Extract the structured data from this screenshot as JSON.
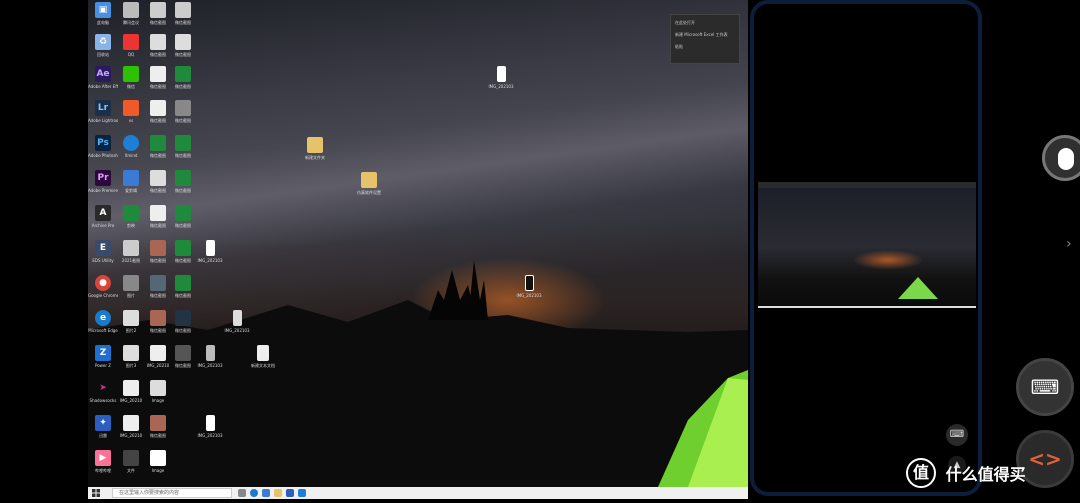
{
  "desktop": {
    "icons": [
      {
        "id": "ic1",
        "label": "此电脑",
        "glyph": "▣",
        "color": "#4a90e2"
      },
      {
        "id": "ic2",
        "label": "回收站",
        "glyph": "♻",
        "color": "#8ab4e8"
      },
      {
        "id": "ic3",
        "label": "Adobe After Effects 2020",
        "glyph": "Ae",
        "color": "#2a1a5e"
      },
      {
        "id": "ic4",
        "label": "Adobe Lightroom",
        "glyph": "Lr",
        "color": "#1a2f4a"
      },
      {
        "id": "ic5",
        "label": "Adobe Photoshop",
        "glyph": "Ps",
        "color": "#0a2440"
      },
      {
        "id": "ic6",
        "label": "Adobe Premiere P...",
        "glyph": "Pr",
        "color": "#2a0a3a"
      },
      {
        "id": "ic7",
        "label": "Archive Pro",
        "glyph": "A",
        "color": "#2a2a2a"
      },
      {
        "id": "ic8",
        "label": "EDS Utility",
        "glyph": "E",
        "color": "#3a4a6a"
      },
      {
        "id": "ic9",
        "label": "Google Chrome",
        "glyph": "●",
        "color": "#d9453a"
      },
      {
        "id": "ic10",
        "label": "Microsoft Edge",
        "glyph": "e",
        "color": "#1a7acb"
      },
      {
        "id": "ic11",
        "label": "Power Z",
        "glyph": "Z",
        "color": "#1e6fd0"
      },
      {
        "id": "ic12",
        "label": "Shadowsocks",
        "glyph": "➤",
        "color": "#c23a8a"
      },
      {
        "id": "ic13",
        "label": "迅雷",
        "glyph": "✦",
        "color": "#2a5fc0"
      },
      {
        "id": "ic14",
        "label": "哔哩哔哩",
        "glyph": "▶",
        "color": "#fb7299"
      }
    ],
    "icons_col2": [
      "腾讯会议",
      "QQ",
      "微信",
      "vs",
      "Xmind",
      "爱剪辑",
      "剪映",
      "Yu",
      "2021截图",
      "图片",
      "图片2",
      "图片3",
      "IMG_20210",
      "文件"
    ],
    "wechat_label": "微信截图",
    "file_center_1": "新建文件夹",
    "file_center_2": "仿真软件设置",
    "file_center_3": "IMG_202103",
    "img_label": "Image",
    "new_doc": "新建文本文档"
  },
  "context_menu": {
    "items": [
      "在此处打开",
      "新建 Microsoft Excel 工作表",
      "粘贴"
    ]
  },
  "taskbar": {
    "search_placeholder": "在这里输入你要搜索的内容"
  },
  "phone": {
    "keyboard_icon": "⌨",
    "up_icon": "▲"
  },
  "right_controls": {
    "keyboard_icon": "⌨",
    "code_icon": "<>",
    "chevron": "›"
  },
  "watermark": {
    "badge": "值",
    "text": "什么值得买"
  }
}
